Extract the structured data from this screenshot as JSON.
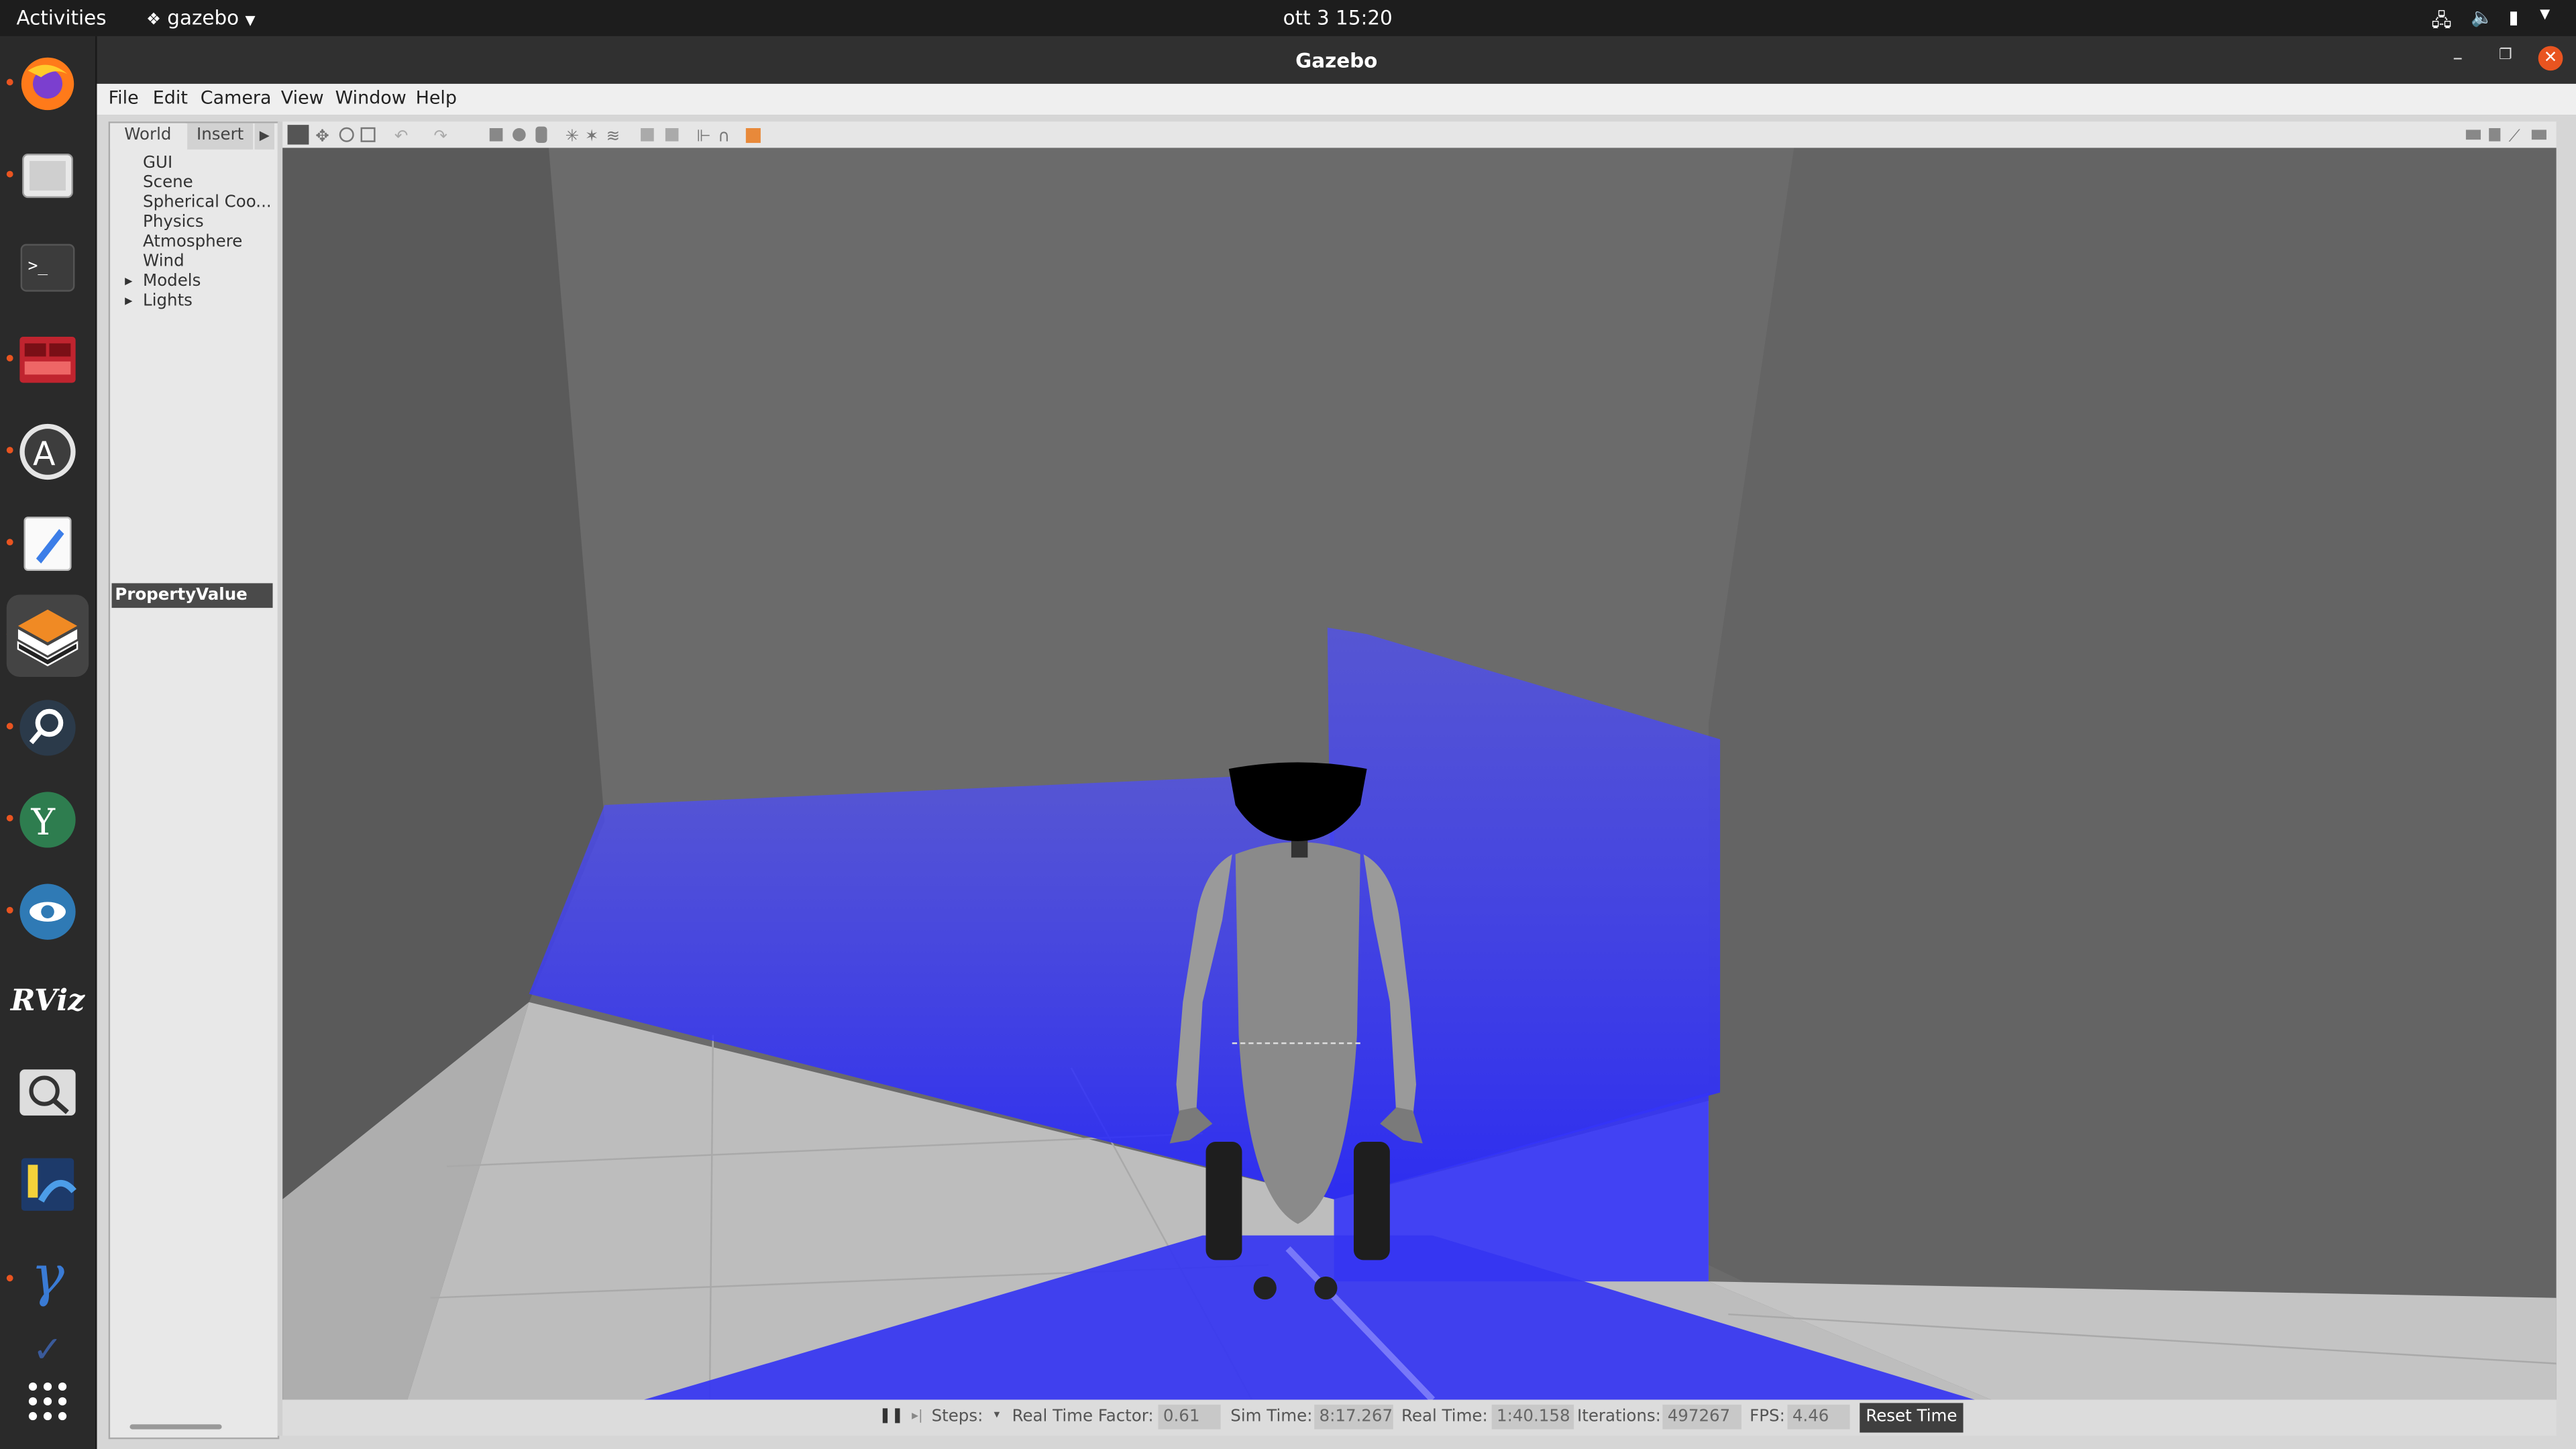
{
  "topbar": {
    "activities": "Activities",
    "app_name": "gazebo",
    "clock": "ott 3  15:20"
  },
  "window": {
    "title": "Gazebo"
  },
  "menu": {
    "items": [
      "File",
      "Edit",
      "Camera",
      "View",
      "Window",
      "Help"
    ]
  },
  "left_panel": {
    "tabs": [
      "World",
      "Insert"
    ],
    "tree": [
      "GUI",
      "Scene",
      "Spherical Coo...",
      "Physics",
      "Atmosphere",
      "Wind",
      "Models",
      "Lights"
    ],
    "property_header": "PropertyValue"
  },
  "status": {
    "steps_label": "Steps:",
    "rtf_label": "Real Time Factor:",
    "rtf_value": "0.61",
    "sim_time_label": "Sim Time:",
    "sim_time_value": "8:17.267",
    "real_time_label": "Real Time:",
    "real_time_value": "1:40.158",
    "iterations_label": "Iterations:",
    "iterations_value": "497267",
    "fps_label": "FPS:",
    "fps_value": "4.46",
    "reset_label": "Reset Time"
  },
  "dock": {
    "apps": [
      "firefox-icon",
      "files-icon",
      "terminal-icon",
      "app-red-icon",
      "software-icon",
      "text-editor-icon",
      "gazebo-icon",
      "search-app-icon",
      "yakuake-icon",
      "eye-app-icon",
      "rviz-icon",
      "magnifier-icon",
      "battery-app-icon",
      "gamma-icon",
      "show-apps-icon"
    ],
    "rviz_text": "RViz"
  },
  "colors": {
    "accent": "#e95420",
    "laser": "#3b3bff"
  }
}
